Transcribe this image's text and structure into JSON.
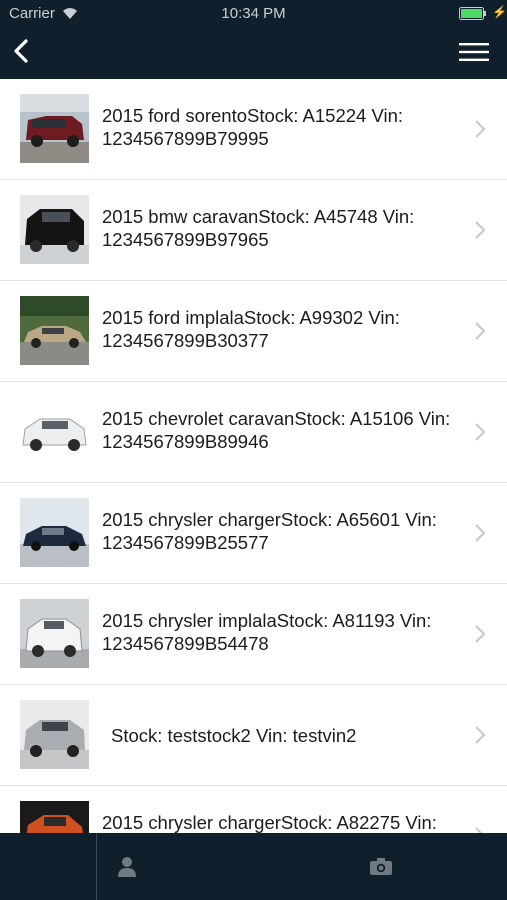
{
  "status_bar": {
    "carrier": "Carrier",
    "time": "10:34 PM",
    "battery_color": "#4cd964"
  },
  "header": {
    "back_icon": "chevron-left-icon",
    "menu_icon": "hamburger-menu-icon",
    "background": "#0f1f2b"
  },
  "inventory": [
    {
      "title": "2015 ford sorentoStock: A15224 Vin: 1234567899B79995",
      "photo": "maroon-suv"
    },
    {
      "title": "2015 bmw caravanStock: A45748 Vin: 1234567899B97965",
      "photo": "black-suv"
    },
    {
      "title": "2015 ford implalaStock: A99302 Vin: 1234567899B30377",
      "photo": "gold-sedan"
    },
    {
      "title": "2015 chevrolet caravanStock: A15106 Vin: 1234567899B89946",
      "photo": "white-crossover"
    },
    {
      "title": "2015 chrysler chargerStock: A65601 Vin: 1234567899B25577",
      "photo": "dark-blue-sedan"
    },
    {
      "title": "2015 chrysler implalaStock: A81193 Vin: 1234567899B54478",
      "photo": "white-sedan"
    },
    {
      "title": "Stock: teststock2 Vin: testvin2",
      "photo": "silver-suv"
    },
    {
      "title": "2015 chrysler chargerStock: A82275 Vin:",
      "photo": "orange-truck"
    }
  ],
  "tab_bar": {
    "tabs": [
      {
        "icon": "person-icon"
      },
      {
        "icon": "camera-icon"
      }
    ]
  }
}
